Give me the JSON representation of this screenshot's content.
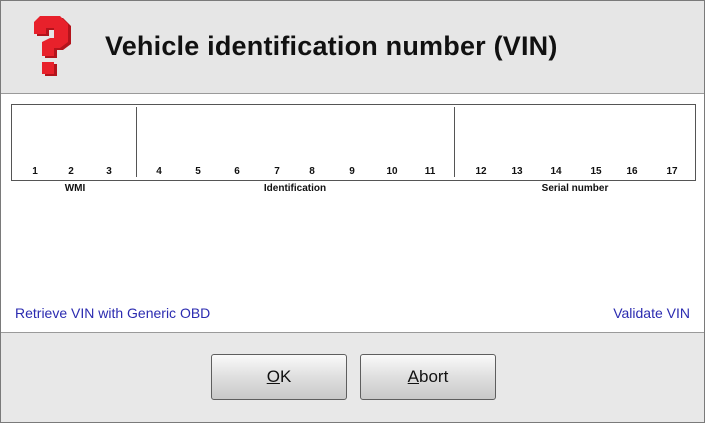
{
  "dialog": {
    "title": "Vehicle identification number (VIN)",
    "icon": "question-mark-icon"
  },
  "vin": {
    "positions": [
      "1",
      "2",
      "3",
      "4",
      "5",
      "6",
      "7",
      "8",
      "9",
      "10",
      "11",
      "12",
      "13",
      "14",
      "15",
      "16",
      "17"
    ],
    "groups": {
      "wmi": "WMI",
      "identification": "Identification",
      "serial": "Serial number"
    }
  },
  "links": {
    "retrieve": "Retrieve VIN with Generic OBD",
    "validate": "Validate VIN"
  },
  "buttons": {
    "ok": {
      "mnemonic": "O",
      "rest": "K"
    },
    "abort": {
      "mnemonic": "A",
      "rest": "bort"
    }
  },
  "colors": {
    "link": "#2b2bb0",
    "icon": "#e8212b"
  }
}
